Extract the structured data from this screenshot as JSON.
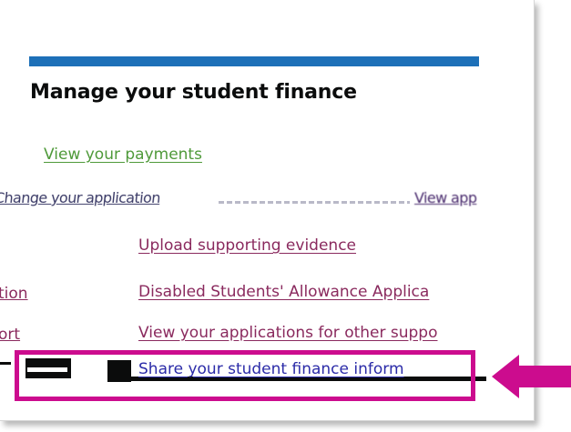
{
  "section": {
    "heading": "Manage your student finance"
  },
  "links": {
    "view_payments": "View your payments",
    "glitch_left": "Change your application",
    "glitch_right": "View app",
    "upload_evidence": "Upload supporting evidence",
    "dsa": "Disabled Students' Allowance Applica",
    "other_support": "View your applications for other suppo",
    "share_info": "Share your student finance inform",
    "clipped_tion": "tion",
    "clipped_ort": "ort"
  },
  "annotation": {
    "highlight_color": "#cc0c8e",
    "arrow_color": "#cc0c8e"
  },
  "colors": {
    "accent_bar": "#1d70b8",
    "visited_link": "#8a2a5e",
    "green_link": "#4f9a3a"
  }
}
